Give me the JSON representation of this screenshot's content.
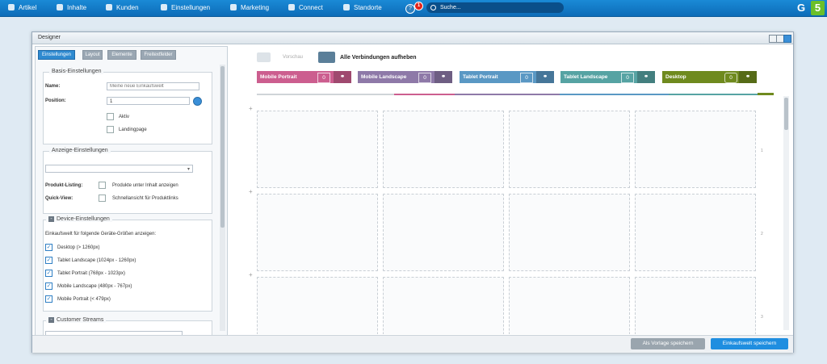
{
  "nav": {
    "items": [
      {
        "label": "Artikel",
        "icon": "box-icon"
      },
      {
        "label": "Inhalte",
        "icon": "document-icon"
      },
      {
        "label": "Kunden",
        "icon": "users-icon"
      },
      {
        "label": "Einstellungen",
        "icon": "gear-icon"
      },
      {
        "label": "Marketing",
        "icon": "chart-icon"
      },
      {
        "label": "Connect",
        "icon": "plug-icon"
      },
      {
        "label": "Standorte",
        "icon": "store-icon"
      }
    ],
    "help": "?",
    "notification_count": "1",
    "search_placeholder": "Suche..."
  },
  "window": {
    "title": "Designer"
  },
  "tabs": [
    "Einstellungen",
    "Layout",
    "Elemente",
    "Freitextfelder"
  ],
  "basis": {
    "legend": "Basis-Einstellungen",
    "name_label": "Name:",
    "name_placeholder": "Meine neue Einkaufswelt",
    "position_label": "Position:",
    "position_value": "1",
    "aktiv": "Aktiv",
    "landingpage": "Landingpage"
  },
  "anzeige": {
    "legend": "Anzeige-Einstellungen",
    "produkt_label": "Produkt-Listing:",
    "produkt_cb": "Produkte unter Inhalt anzeigen",
    "quick_label": "Quick-View:",
    "quick_cb": "Schnellansicht für Produktlinks"
  },
  "device": {
    "legend": "Device-Einstellungen",
    "intro": "Einkaufswelt für folgende Geräte-Größen anzeigen:",
    "items": [
      "Desktop (> 1260px)",
      "Tablet Landscape (1024px - 1260px)",
      "Tablet Portrait (768px - 1023px)",
      "Mobile Landscape (480px - 767px)",
      "Mobile Portrait (< 479px)"
    ]
  },
  "streams": {
    "legend": "Customer Streams"
  },
  "designer": {
    "vorschau": "Vorschau",
    "alle": "Alle Verbindungen aufheben",
    "devices": [
      {
        "name": "Mobile Portrait",
        "count": "0",
        "color": "#cc5e8f"
      },
      {
        "name": "Mobile Landscape",
        "count": "0",
        "color": "#8e79a8"
      },
      {
        "name": "Tablet Portrait",
        "count": "0",
        "color": "#5a98c4"
      },
      {
        "name": "Tablet Landscape",
        "count": "0",
        "color": "#56a3a3"
      },
      {
        "name": "Desktop",
        "count": "0",
        "color": "#6f8a1e"
      }
    ],
    "row_marks": [
      "1",
      "2",
      "3"
    ]
  },
  "footer": {
    "vorlage": "Als Vorlage speichern",
    "speichern": "Einkaufswelt speichern"
  }
}
